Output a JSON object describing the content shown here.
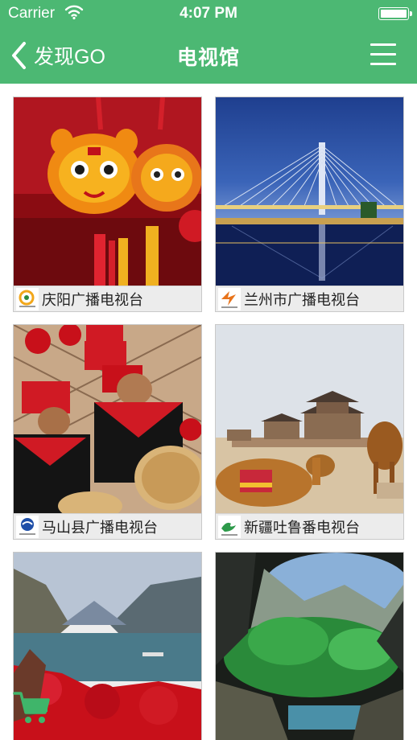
{
  "status_bar": {
    "carrier": "Carrier",
    "time": "4:07 PM"
  },
  "nav": {
    "back_label": "发现GO",
    "title": "电视馆"
  },
  "stations": [
    {
      "name": "庆阳广播电视台",
      "image": "chinese-tiger-charm-photo",
      "logo": "qingyang-tv-logo"
    },
    {
      "name": "兰州市广播电视台",
      "image": "lanzhou-bridge-night-photo",
      "logo": "lanzhou-tv-logo"
    },
    {
      "name": "马山县广播电视台",
      "image": "zhuang-drummers-photo",
      "logo": "mashan-tv-logo"
    },
    {
      "name": "新疆吐鲁番电视台",
      "image": "desert-camels-fortress-photo",
      "logo": "turpan-tv-logo"
    },
    {
      "name": "",
      "image": "river-gorge-red-leaves-photo",
      "logo": ""
    },
    {
      "name": "",
      "image": "green-karst-cave-photo",
      "logo": ""
    }
  ],
  "colors": {
    "header_green": "#4cb873",
    "caption_bg": "#ececec"
  },
  "icons": {
    "back": "chevron-left-icon",
    "menu": "hamburger-menu-icon",
    "cart": "shopping-cart-icon"
  }
}
